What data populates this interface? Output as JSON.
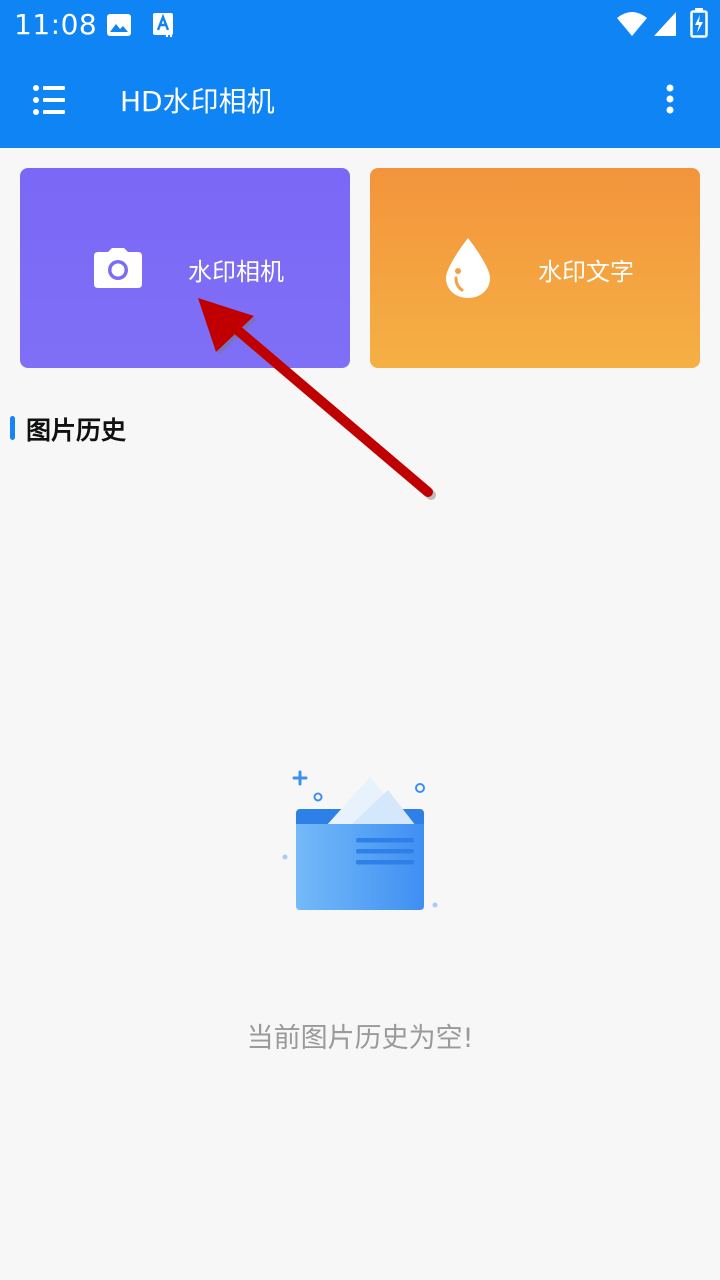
{
  "status_bar": {
    "time": "11:08",
    "icons": [
      "image-icon",
      "text-recognition-icon",
      "wifi-icon",
      "signal-icon",
      "battery-charging-icon"
    ]
  },
  "app_bar": {
    "title": "HD水印相机",
    "menu_icon": "menu-list-icon",
    "overflow_icon": "more-vertical-icon"
  },
  "cards": [
    {
      "label": "水印相机",
      "icon": "camera-icon",
      "color": "#7b6cf6"
    },
    {
      "label": "水印文字",
      "icon": "water-drop-icon",
      "color": "#f4a13f"
    }
  ],
  "history": {
    "title": "图片历史",
    "empty_message": "当前图片历史为空!",
    "empty_icon": "empty-folder-icon"
  },
  "colors": {
    "primary": "#0f84f4",
    "background": "#f7f7f7",
    "annotation_arrow": "#c00000"
  }
}
